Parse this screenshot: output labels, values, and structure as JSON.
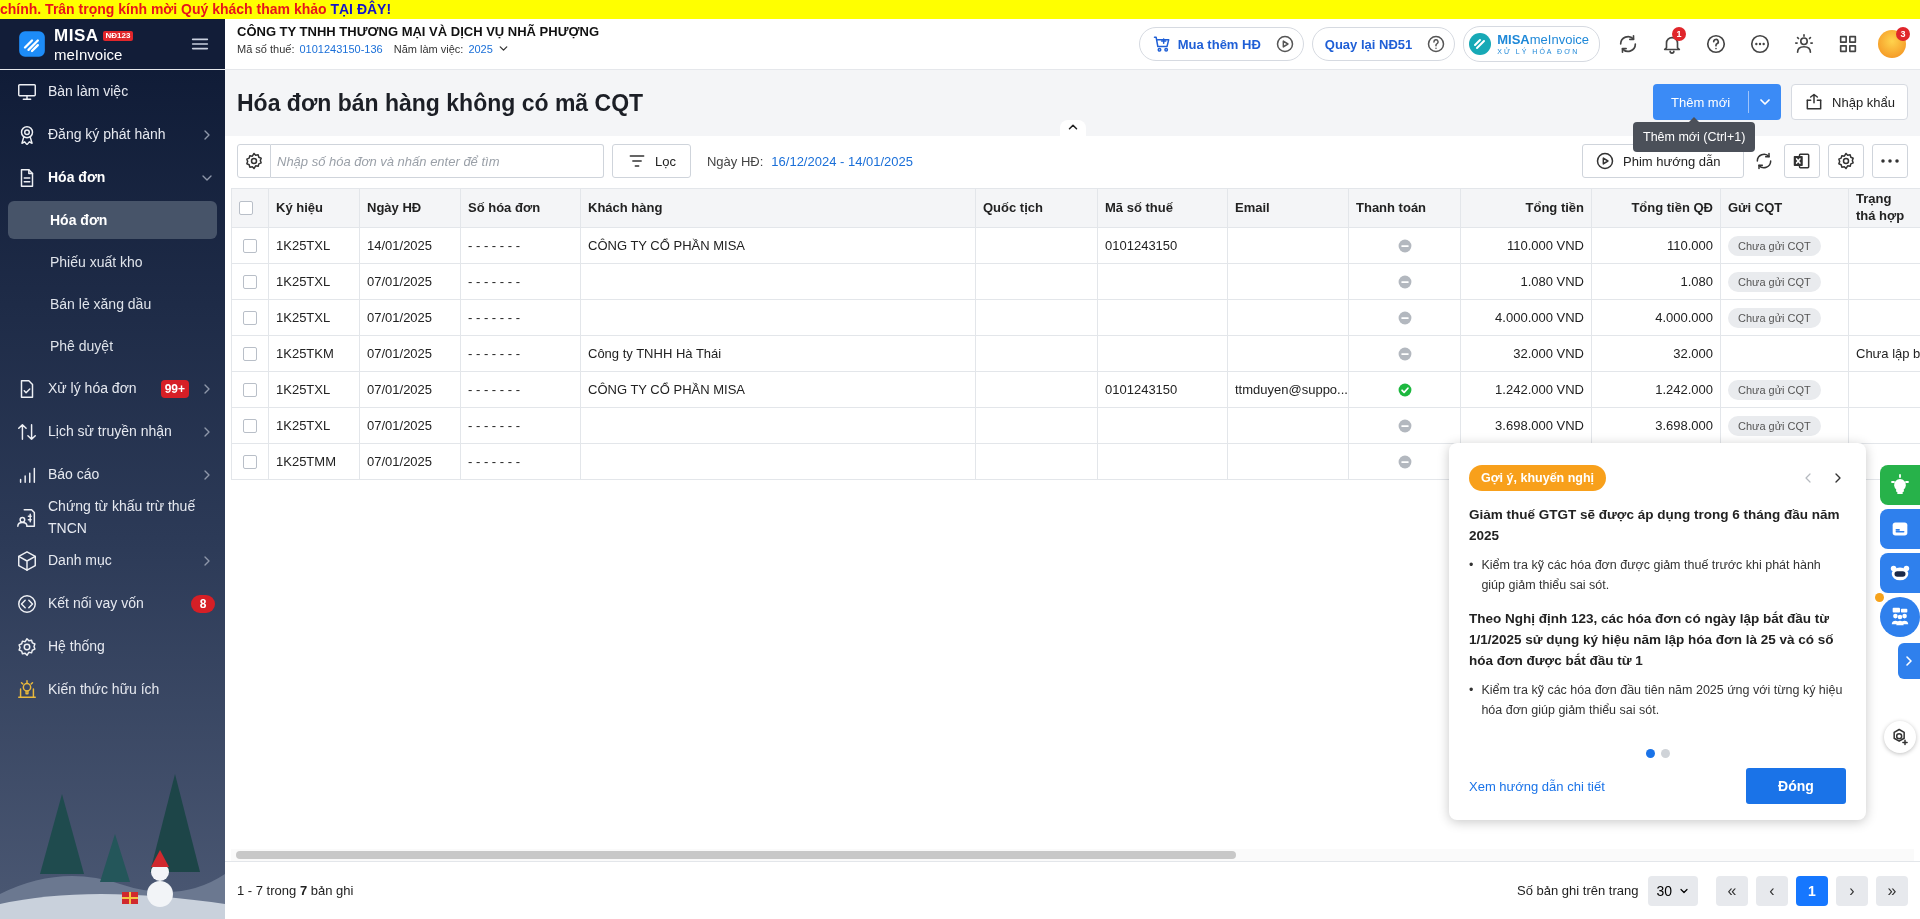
{
  "banner": {
    "text": "chính. Trân trọng kính mời Quý khách tham khảo",
    "link": "TẠI ĐÂY!"
  },
  "header": {
    "logo": {
      "name": "MISA",
      "product": "meInvoice",
      "badge": "NĐ123"
    },
    "company": "CÔNG TY TNHH THƯƠNG MẠI VÀ DỊCH VỤ NHÃ PHƯỢNG",
    "tax_label": "Mã số thuế:",
    "tax_code": "0101243150-136",
    "year_label": "Năm làm việc:",
    "year": "2025",
    "buttons": [
      {
        "label": "Mua thêm HĐ",
        "kind": "buy"
      },
      {
        "label": "Quay lại NĐ51",
        "kind": "back"
      }
    ],
    "brand": {
      "title": "**MISA**meInvoice",
      "subtitle": "XỬ LÝ HÓA ĐƠN"
    },
    "notification_count": "1",
    "avatar_badge": "3"
  },
  "sidebar": {
    "items": [
      {
        "label": "Bàn làm việc"
      },
      {
        "label": "Đăng ký phát hành",
        "expanded": false
      },
      {
        "label": "Hóa đơn",
        "expanded": true,
        "children": [
          {
            "label": "Hóa đơn",
            "selected": true
          },
          {
            "label": "Phiếu xuất kho",
            "selected": false
          },
          {
            "label": "Bán lẻ xăng dầu",
            "selected": false
          },
          {
            "label": "Phê duyệt",
            "selected": false
          }
        ]
      },
      {
        "label": "Xử lý hóa đơn",
        "badge": "99+",
        "expanded": false
      },
      {
        "label": "Lịch sử truyền nhận",
        "expanded": false
      },
      {
        "label": "Báo cáo",
        "expanded": false
      },
      {
        "label": "Chứng từ khấu trừ thuế TNCN"
      },
      {
        "label": "Danh mục",
        "expanded": false
      },
      {
        "label": "Kết nối vay vốn",
        "badge": "8"
      },
      {
        "label": "Hệ thống"
      },
      {
        "label": "Kiến thức hữu ích"
      }
    ]
  },
  "page": {
    "title": "Hóa đơn bán hàng không có mã CQT",
    "add_button": "Thêm mới",
    "import_button": "Nhập khẩu",
    "tooltip": "Thêm mới (Ctrl+1)"
  },
  "toolbar": {
    "search": {
      "placeholder": "Nhập số hóa đơn và nhấn enter để tìm"
    },
    "filter_button": "Lọc",
    "date_label": "Ngày HĐ:",
    "date_range": "16/12/2024 - 14/01/2025",
    "guide_button": "Phim hướng dẫn"
  },
  "table": {
    "all_selected": false,
    "columns": [
      "Ký hiệu",
      "Ngày HĐ",
      "Số hóa đơn",
      "Khách hàng",
      "Quốc tịch",
      "Mã số thuế",
      "Email",
      "Thanh toán",
      "Tổng tiền",
      "Tổng tiền QĐ",
      "Gửi CQT",
      "Trạng thá hợp"
    ],
    "rows": [
      {
        "selected": false,
        "symbol": "1K25TXL",
        "date": "14/01/2025",
        "number": "- - - - - - -",
        "customer": "CÔNG TY CỔ PHẦN MISA",
        "tax_code": "0101243150",
        "paid": false,
        "total": "110.000 VND",
        "total_qd": "110.000",
        "cqt": "Chưa gửi CQT"
      },
      {
        "selected": false,
        "symbol": "1K25TXL",
        "date": "07/01/2025",
        "number": "- - - - - - -",
        "paid": false,
        "total": "1.080 VND",
        "total_qd": "1.080",
        "cqt": "Chưa gửi CQT"
      },
      {
        "selected": false,
        "symbol": "1K25TXL",
        "date": "07/01/2025",
        "number": "- - - - - - -",
        "paid": false,
        "total": "4.000.000 VND",
        "total_qd": "4.000.000",
        "cqt": "Chưa gửi CQT"
      },
      {
        "selected": false,
        "symbol": "1K25TKM",
        "date": "07/01/2025",
        "number": "- - - - - - -",
        "customer": "Công ty TNHH Hà Thái",
        "paid": false,
        "total": "32.000 VND",
        "total_qd": "32.000",
        "status": "Chưa lập b"
      },
      {
        "selected": false,
        "symbol": "1K25TXL",
        "date": "07/01/2025",
        "number": "- - - - - - -",
        "customer": "CÔNG TY CỔ PHẦN MISA",
        "tax_code": "0101243150",
        "email": "ttmduyen@suppo...",
        "paid": true,
        "total": "1.242.000 VND",
        "total_qd": "1.242.000",
        "cqt": "Chưa gửi CQT"
      },
      {
        "selected": false,
        "symbol": "1K25TXL",
        "date": "07/01/2025",
        "number": "- - - - - - -",
        "paid": false,
        "total": "3.698.000 VND",
        "total_qd": "3.698.000",
        "cqt": "Chưa gửi CQT"
      },
      {
        "selected": false,
        "symbol": "1K25TMM",
        "date": "07/01/2025",
        "number": "- - - - - - -",
        "paid": false
      }
    ]
  },
  "footer": {
    "summary": "1 - 7 trong **7** bản ghi",
    "per_page_label": "Số bản ghi trên trang",
    "per_page": "30",
    "first": "«",
    "prev": "‹",
    "pages": [
      {
        "label": "1",
        "selected": true
      }
    ],
    "next": "›",
    "last": "»"
  },
  "tip": {
    "tag": "Gợi ý, khuyến nghị",
    "sections": [
      {
        "heading": "Giảm thuế GTGT sẽ được áp dụng trong 6 tháng đầu năm 2025",
        "bullets": [
          {
            "marker": "•",
            "text": "Kiểm tra kỹ các hóa đơn được giảm thuế trước khi phát hành giúp giảm thiểu sai sót."
          }
        ]
      },
      {
        "heading": "Theo Nghị định 123, các hóa đơn có ngày lập bắt đầu từ 1/1/2025 sử dụng ký hiệu năm lập hóa đơn là 25 và có số hóa đơn được bắt đầu từ 1",
        "bullets": [
          {
            "marker": "•",
            "text": "Kiểm tra kỹ các hóa đơn đầu tiên năm 2025 ứng với từng ký hiệu hóa đơn giúp giảm thiểu sai sót."
          }
        ]
      }
    ],
    "dots": [
      {
        "selected": true
      },
      {
        "selected": false
      }
    ],
    "link": "Xem hướng dẫn chi tiết",
    "close_button": "Đóng"
  }
}
